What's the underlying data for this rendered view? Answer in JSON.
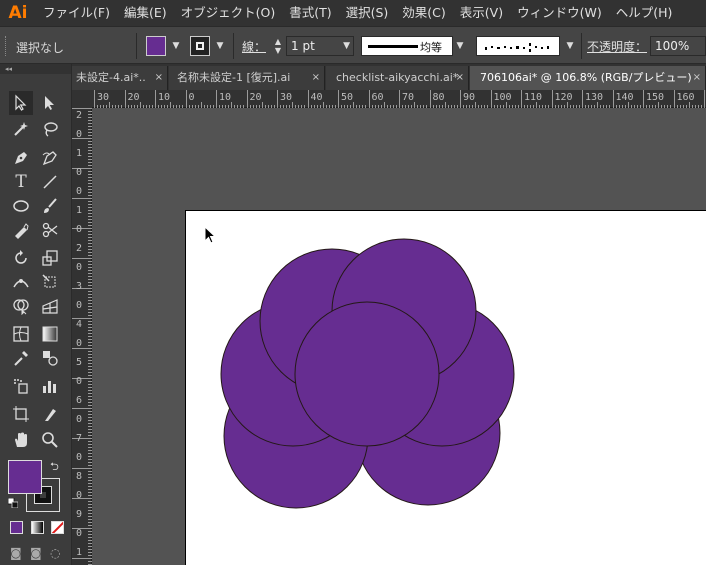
{
  "app": {
    "logo": "Ai"
  },
  "menu": [
    "ファイル(F)",
    "編集(E)",
    "オブジェクト(O)",
    "書式(T)",
    "選択(S)",
    "効果(C)",
    "表示(V)",
    "ウィンドウ(W)",
    "ヘルプ(H)"
  ],
  "control": {
    "selection_label": "選択なし",
    "stroke_label": "線：",
    "stroke_weight": "1 pt",
    "profile_label": "均等",
    "opacity_label": "不透明度：",
    "opacity_value": "100%",
    "fill_color": "#662d91",
    "stroke_color": "#000000"
  },
  "tabs": [
    {
      "label": "未設定-4.ai*..",
      "close": "×"
    },
    {
      "label": "名称未設定-1 [復元].ai",
      "close": "×"
    },
    {
      "label": "checklist-aikyacchi.ai*",
      "close": "×"
    },
    {
      "label": "706106ai* @ 106.8% (RGB/プレビュー)",
      "close": "×"
    }
  ],
  "ruler_h": [
    "30",
    "20",
    "10",
    "0",
    "10",
    "20",
    "30",
    "40",
    "50",
    "60",
    "70",
    "80",
    "90",
    "100",
    "110",
    "120",
    "130",
    "140",
    "150",
    "160"
  ],
  "ruler_v": [
    "2",
    "0",
    "1",
    "0",
    "0",
    "1",
    "0",
    "2",
    "0",
    "3",
    "0",
    "4",
    "0",
    "5",
    "0",
    "6",
    "0",
    "7",
    "0",
    "8",
    "0",
    "9",
    "0",
    "1"
  ],
  "artwork": {
    "shape_fill": "#662d91",
    "shape_stroke": "#231815",
    "circles": 7
  },
  "icons": {
    "fill_stroke": "fill-stroke-widget",
    "swap": "swap-icon",
    "cursor": "arrow-cursor-icon"
  }
}
